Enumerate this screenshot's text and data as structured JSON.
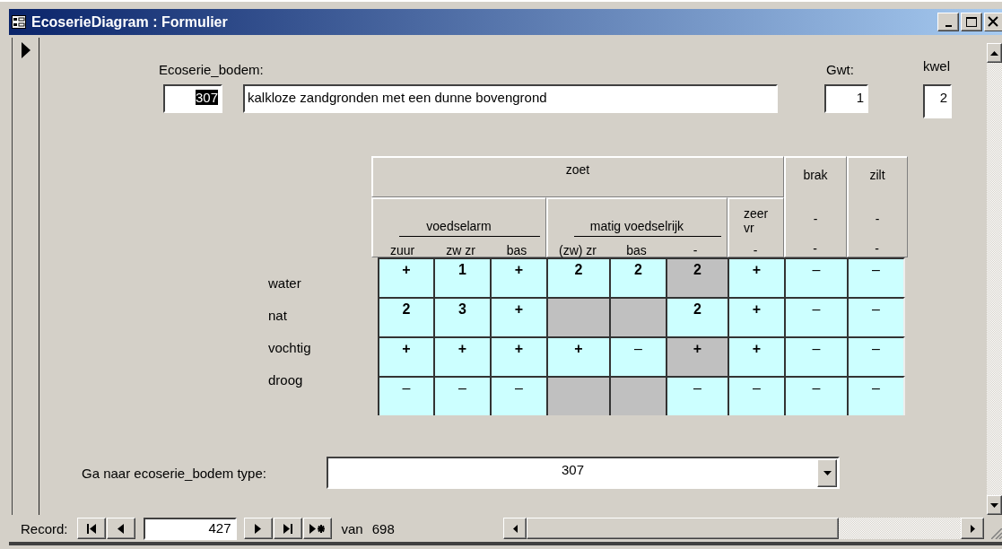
{
  "window": {
    "title": "EcoserieDiagram : Formulier"
  },
  "record": {
    "ecoserie_label": "Ecoserie_bodem:",
    "code": "307",
    "code_selected": true,
    "description": "kalkloze zandgronden met een dunne bovengrond",
    "gwt_label": "Gwt:",
    "gwt": "1",
    "kwel_label": "kwel",
    "kwel": "2"
  },
  "diagram": {
    "groups": [
      {
        "label": "zoet",
        "subgroups": [
          {
            "label": "voedselarm",
            "underlined": true,
            "columns": [
              "zuur",
              "zw zr",
              "bas"
            ]
          },
          {
            "label": "matig voedselrijk",
            "underlined": true,
            "columns": [
              "(zw) zr",
              "bas",
              "-"
            ]
          },
          {
            "label": "zeer vr",
            "underlined": false,
            "columns": [
              "-"
            ]
          }
        ]
      },
      {
        "label": "brak",
        "subgroups": [
          {
            "label": "-",
            "underlined": false,
            "columns": [
              "-"
            ]
          }
        ]
      },
      {
        "label": "zilt",
        "subgroups": [
          {
            "label": "-",
            "underlined": false,
            "columns": [
              "-"
            ]
          }
        ]
      }
    ],
    "rows": [
      {
        "label": "water",
        "cells": [
          {
            "value": "+",
            "shaded": false
          },
          {
            "value": "1",
            "shaded": false
          },
          {
            "value": "+",
            "shaded": false
          },
          {
            "value": "2",
            "shaded": false
          },
          {
            "value": "2",
            "shaded": false
          },
          {
            "value": "2",
            "shaded": true
          },
          {
            "value": "+",
            "shaded": false
          },
          {
            "value": "–",
            "shaded": false
          },
          {
            "value": "–",
            "shaded": false
          }
        ]
      },
      {
        "label": "nat",
        "cells": [
          {
            "value": "2",
            "shaded": false
          },
          {
            "value": "3",
            "shaded": false
          },
          {
            "value": "+",
            "shaded": false
          },
          {
            "shaded": true
          },
          {
            "shaded": true
          },
          {
            "value": "2",
            "shaded": false
          },
          {
            "value": "+",
            "shaded": false
          },
          {
            "value": "–",
            "shaded": false
          },
          {
            "value": "–",
            "shaded": false
          }
        ]
      },
      {
        "label": "vochtig",
        "cells": [
          {
            "value": "+",
            "shaded": false
          },
          {
            "value": "+",
            "shaded": false
          },
          {
            "value": "+",
            "shaded": false
          },
          {
            "value": "+",
            "shaded": false
          },
          {
            "value": "–",
            "shaded": false
          },
          {
            "value": "+",
            "shaded": true
          },
          {
            "value": "+",
            "shaded": false
          },
          {
            "value": "–",
            "shaded": false
          },
          {
            "value": "–",
            "shaded": false
          }
        ]
      },
      {
        "label": "droog",
        "cells": [
          {
            "value": "–",
            "shaded": false
          },
          {
            "value": "–",
            "shaded": false
          },
          {
            "value": "–",
            "shaded": false
          },
          {
            "shaded": true
          },
          {
            "shaded": true
          },
          {
            "value": "–",
            "shaded": false
          },
          {
            "value": "–",
            "shaded": false
          },
          {
            "value": "–",
            "shaded": false
          },
          {
            "value": "–",
            "shaded": false
          }
        ]
      }
    ]
  },
  "lookup": {
    "label": "Ga naar ecoserie_bodem type:",
    "value": "307"
  },
  "navigation": {
    "label": "Record:",
    "current": "427",
    "of_label": "van",
    "total": "698"
  }
}
